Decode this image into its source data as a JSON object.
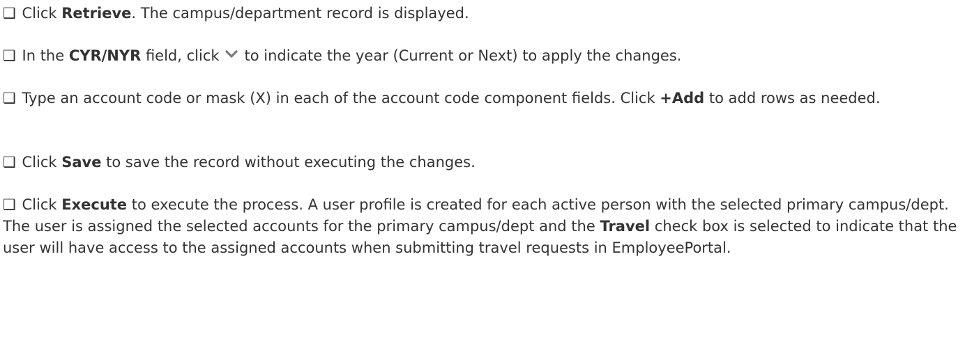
{
  "checkbox_glyph": "❑",
  "steps": [
    {
      "pre": "Click ",
      "bold": "Retrieve",
      "post": ". The campus/department record is displayed."
    },
    {
      "pre": "In the ",
      "bold": "CYR/NYR",
      "mid": " field, click",
      "icon": "chevron-down-icon",
      "post": "to indicate the year (Current or Next) to apply the changes."
    },
    {
      "pre": "Type an account code or mask (X) in each of the account code component fields. Click ",
      "bold": "+Add",
      "post": " to add rows as needed."
    },
    {
      "pre": "Click ",
      "bold": "Save",
      "post": " to save the record without executing the changes."
    },
    {
      "pre": "Click ",
      "bold": "Execute",
      "post": " to execute the process. A user profile is created for each active person with the selected primary campus/dept. The user is assigned the selected accounts for the primary campus/dept and the ",
      "bold2": "Travel",
      "post2": " check box is selected to indicate that the user will have access to the assigned accounts when submitting travel requests in EmployeePortal."
    }
  ],
  "colors": {
    "text": "#333333",
    "chevron": "#7a7a7a"
  }
}
